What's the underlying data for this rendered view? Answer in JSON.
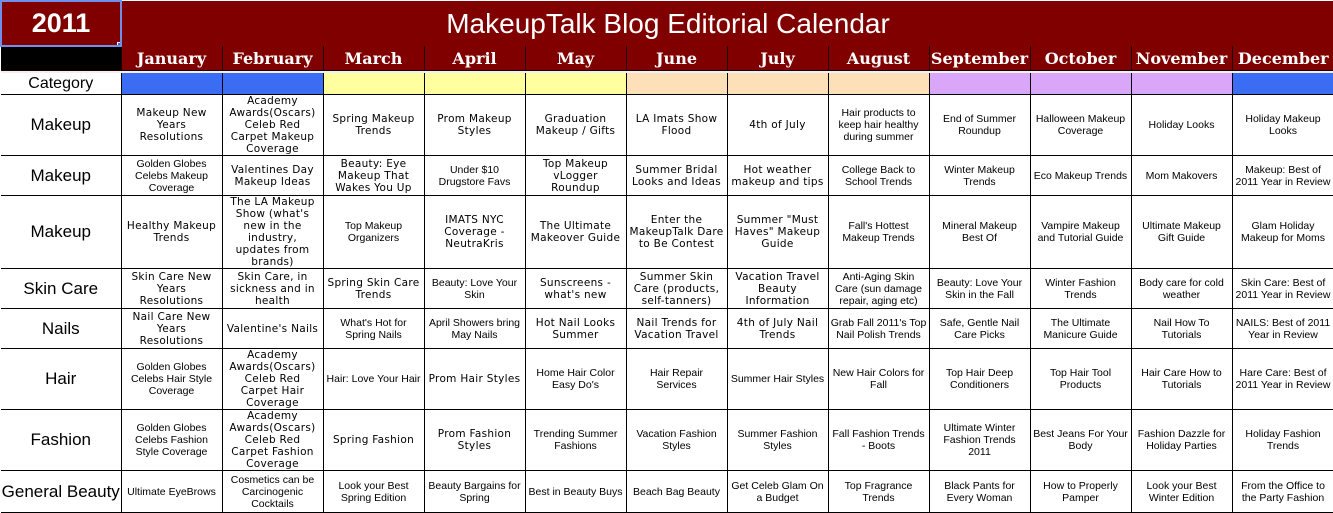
{
  "header": {
    "year": "2011",
    "title": "MakeupTalk Blog Editorial Calendar"
  },
  "months": [
    "January",
    "February",
    "March",
    "April",
    "May",
    "June",
    "July",
    "August",
    "September",
    "October",
    "November",
    "December"
  ],
  "category_label": "Category",
  "season_colors": [
    "#3a6cf4",
    "#3a6cf4",
    "#ffffa0",
    "#ffffa0",
    "#ffffa0",
    "#fde0b8",
    "#fde0b8",
    "#fde0b8",
    "#d9a6fa",
    "#d9a6fa",
    "#d9a6fa",
    "#3a6cf4"
  ],
  "colors": {
    "header_bg": "#800000",
    "header_text": "#ffffff"
  },
  "rows": [
    {
      "category": "Makeup",
      "cells": [
        "Makeup New Years Resolutions",
        "Academy Awards(Oscars) Celeb Red Carpet Makeup Coverage",
        "Spring Makeup Trends",
        "Prom Makeup Styles",
        "Graduation Makeup / Gifts",
        "LA Imats Show Flood",
        "4th of July",
        "Hair products to keep hair healthy during summer",
        "End of Summer Roundup",
        "Halloween Makeup Coverage",
        "Holiday Looks",
        "Holiday Makeup Looks"
      ]
    },
    {
      "category": "Makeup",
      "cells": [
        "Golden Globes Celebs Makeup Coverage",
        "Valentines Day Makeup Ideas",
        "Beauty: Eye Makeup That Wakes You Up",
        "Under $10 Drugstore Favs",
        "Top Makeup vLogger Roundup",
        "Summer Bridal Looks and Ideas",
        "Hot weather makeup and tips",
        "College Back to School Trends",
        "Winter Makeup Trends",
        "Eco Makeup Trends",
        "Mom Makovers",
        "Makeup: Best of 2011 Year in Review"
      ]
    },
    {
      "category": "Makeup",
      "cells": [
        "Healthy Makeup Trends",
        "The LA Makeup Show (what's new in the industry, updates from brands)",
        "Top Makeup Organizers",
        "IMATS NYC Coverage - NeutraKris",
        "The Ultimate Makeover Guide",
        "Enter the MakeupTalk Dare to Be Contest",
        "Summer \"Must Haves\" Makeup Guide",
        "Fall's Hottest Makeup Trends",
        "Mineral Makeup Best Of",
        "Vampire Makeup and Tutorial Guide",
        "Ultimate Makeup Gift Guide",
        "Glam Holiday Makeup for Moms"
      ]
    },
    {
      "category": "Skin Care",
      "cells": [
        "Skin Care New Years Resolutions",
        "Skin Care, in sickness and in health",
        "Spring Skin Care Trends",
        "Beauty: Love Your Skin",
        "Sunscreens - what's new",
        "Summer Skin Care (products, self-tanners)",
        "Vacation Travel Beauty Information",
        "Anti-Aging Skin Care (sun damage repair, aging etc)",
        "Beauty: Love Your Skin in the Fall",
        "Winter Fashion Trends",
        "Body care for cold weather",
        "Skin Care: Best of 2011 Year in Review"
      ]
    },
    {
      "category": "Nails",
      "cells": [
        "Nail Care New Years Resolutions",
        "Valentine's Nails",
        "What's Hot for Spring Nails",
        "April Showers bring May Nails",
        "Hot Nail Looks Summer",
        "Nail Trends for Vacation Travel",
        "4th of July Nail Trends",
        "Grab Fall 2011's Top Nail Polish Trends",
        "Safe, Gentle Nail Care Picks",
        "The Ultimate Manicure Guide",
        "Nail How To Tutorials",
        "NAILS: Best of 2011 Year in Review"
      ]
    },
    {
      "category": "Hair",
      "cells": [
        "Golden Globes Celebs Hair Style Coverage",
        "Academy Awards(Oscars) Celeb Red Carpet Hair Coverage",
        "Hair: Love Your Hair",
        "Prom Hair Styles",
        "Home Hair Color Easy Do's",
        "Hair Repair Services",
        "Summer Hair Styles",
        "New Hair Colors for Fall",
        "Top Hair Deep Conditioners",
        "Top Hair Tool Products",
        "Hair Care How to Tutorials",
        "Hare Care: Best of 2011 Year in Review"
      ]
    },
    {
      "category": "Fashion",
      "cells": [
        "Golden Globes Celebs Fashion Style Coverage",
        "Academy Awards(Oscars) Celeb Red Carpet Fashion Coverage",
        "Spring Fashion",
        "Prom Fashion Styles",
        "Trending Summer Fashions",
        "Vacation Fashion Styles",
        "Summer Fashion Styles",
        "Fall Fashion Trends - Boots",
        "Ultimate Winter Fashion Trends 2011",
        "Best Jeans For Your Body",
        "Fashion Dazzle for Holiday Parties",
        "Holiday Fashion Trends"
      ]
    },
    {
      "category": "General Beauty",
      "cells": [
        "Ultimate EyeBrows",
        "Cosmetics can be Carcinogenic Cocktails",
        "Look your Best Spring Edition",
        "Beauty Bargains for Spring",
        "Best in Beauty Buys",
        "Beach Bag Beauty",
        "Get Celeb Glam On a Budget",
        "Top Fragrance Trends",
        "Black Pants for Every Woman",
        "How to Properly Pamper",
        "Look your Best Winter Edition",
        "From the Office to the Party Fashion"
      ]
    }
  ]
}
